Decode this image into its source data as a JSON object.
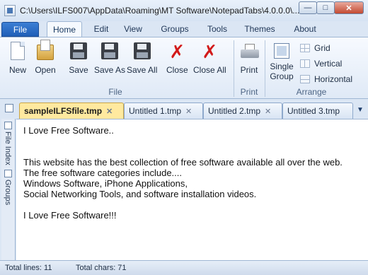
{
  "window": {
    "title": "C:\\Users\\ILFS007\\AppData\\Roaming\\MT Software\\NotepadTabs\\4.0.0.0\\..."
  },
  "ribbon_tabs": [
    "File",
    "Home",
    "Edit",
    "View",
    "Groups",
    "Tools",
    "Themes",
    "About"
  ],
  "ribbon": {
    "new": "New",
    "open": "Open",
    "save": "Save",
    "save_as": "Save As",
    "save_all": "Save All",
    "close": "Close",
    "close_all": "Close All",
    "print": "Print",
    "single_group": "Single Group",
    "grid": "Grid",
    "vertical": "Vertical",
    "horizontal": "Horizontal",
    "groups": {
      "file": "File",
      "print": "Print",
      "arrange": "Arrange"
    }
  },
  "doc_tabs": [
    {
      "label": "sampleILFSfile.tmp"
    },
    {
      "label": "Untitled 1.tmp"
    },
    {
      "label": "Untitled 2.tmp"
    },
    {
      "label": "Untitled 3.tmp"
    }
  ],
  "side_panel": {
    "file_index": "File Index",
    "groups": "Groups"
  },
  "editor": {
    "lines": [
      "I Love Free Software..",
      "",
      "",
      "This website has the best collection of free software available all over the web.",
      "The free software categories include....",
      "Windows Software, iPhone Applications,",
      "Social Networking Tools, and software installation videos.",
      "",
      "I Love Free Software!!!"
    ]
  },
  "status": {
    "total_lines": "Total lines: 11",
    "total_chars": "Total chars: 71"
  }
}
